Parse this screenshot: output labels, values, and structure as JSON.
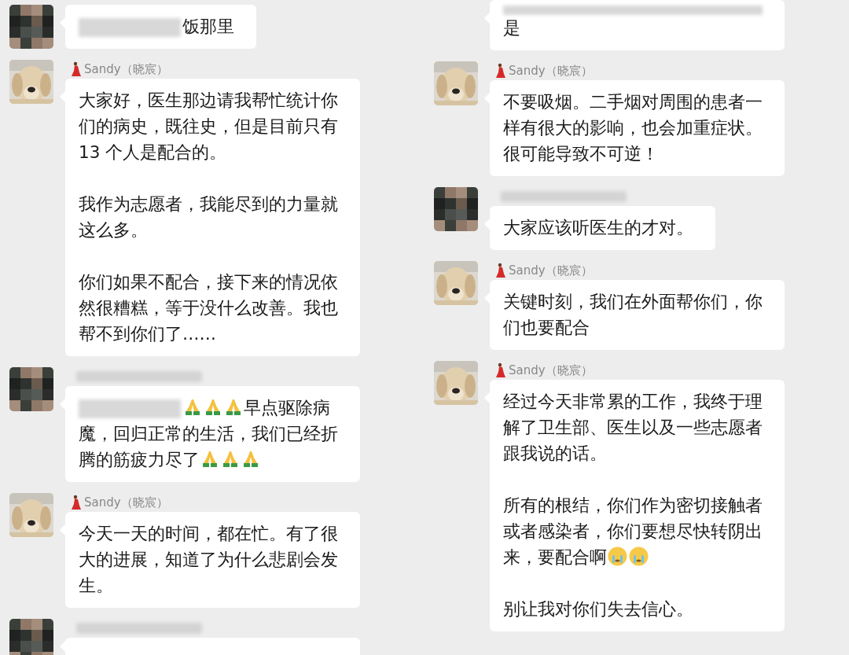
{
  "columns": [
    {
      "messages": [
        {
          "avatar": {
            "kind": "mosaic"
          },
          "paragraphs": [
            [
              [
                {
                  "kind": "blur"
                },
                {
                  "kind": "text",
                  "text": "饭那里"
                }
              ]
            ]
          ]
        },
        {
          "avatar": {
            "kind": "dog"
          },
          "sender": "Sandy（晓宸）",
          "paragraphs": [
            [
              [
                {
                  "kind": "text",
                  "text": "大家好，医生那边请我帮忙统计你们的病史，既往史，但是目前只有13 个人是配合的。"
                }
              ]
            ],
            [
              [
                {
                  "kind": "text",
                  "text": "我作为志愿者，我能尽到的力量就这么多。"
                }
              ]
            ],
            [
              [
                {
                  "kind": "text",
                  "text": "你们如果不配合，接下来的情况依然很糟糕，等于没什么改善。我也帮不到你们了……"
                }
              ]
            ]
          ]
        },
        {
          "avatar": {
            "kind": "mosaic"
          },
          "sender_blurred": true,
          "paragraphs": [
            [
              [
                {
                  "kind": "blur"
                },
                {
                  "kind": "pray"
                },
                {
                  "kind": "pray"
                },
                {
                  "kind": "pray"
                },
                {
                  "kind": "text",
                  "text": "早点驱除病"
                }
              ],
              [
                {
                  "kind": "text",
                  "text": "魔，回归正常的生活，我们已经折"
                }
              ],
              [
                {
                  "kind": "text",
                  "text": "腾的筋疲力尽了"
                },
                {
                  "kind": "pray"
                },
                {
                  "kind": "pray"
                },
                {
                  "kind": "pray"
                }
              ]
            ]
          ]
        },
        {
          "avatar": {
            "kind": "dog"
          },
          "sender": "Sandy（晓宸）",
          "paragraphs": [
            [
              [
                {
                  "kind": "text",
                  "text": "今天一天的时间，都在忙。有了很大的进展，知道了为什么悲剧会发生。"
                }
              ]
            ]
          ]
        },
        {
          "avatar": {
            "kind": "mosaic"
          },
          "sender_blurred": true
        }
      ]
    },
    {
      "messages": [
        {
          "paragraphs": [
            [
              [
                {
                  "kind": "blur"
                }
              ],
              [
                {
                  "kind": "text",
                  "text": "是"
                }
              ]
            ]
          ]
        },
        {
          "avatar": {
            "kind": "dog"
          },
          "sender": "Sandy（晓宸）",
          "paragraphs": [
            [
              [
                {
                  "kind": "text",
                  "text": "不要吸烟。二手烟对周围的患者一样有很大的影响，也会加重症状。很可能导致不可逆！"
                }
              ]
            ]
          ]
        },
        {
          "avatar": {
            "kind": "mosaic"
          },
          "sender_blurred": true,
          "paragraphs": [
            [
              [
                {
                  "kind": "text",
                  "text": "大家应该听医生的才对。"
                }
              ]
            ]
          ]
        },
        {
          "avatar": {
            "kind": "dog"
          },
          "sender": "Sandy（晓宸）",
          "paragraphs": [
            [
              [
                {
                  "kind": "text",
                  "text": "关键时刻，我们在外面帮你们，你们也要配合"
                }
              ]
            ]
          ]
        },
        {
          "avatar": {
            "kind": "dog"
          },
          "sender": "Sandy（晓宸）",
          "paragraphs": [
            [
              [
                {
                  "kind": "text",
                  "text": "经过今天非常累的工作，我终于理解了卫生部、医生以及一些志愿者跟我说的话。"
                }
              ]
            ],
            [
              [
                {
                  "kind": "text",
                  "text": "所有的根结，你们作为密切接触者或者感染者，你们要想尽快转阴出"
                }
              ],
              [
                {
                  "kind": "text",
                  "text": "来，要配合啊"
                },
                {
                  "kind": "cry"
                },
                {
                  "kind": "cry"
                }
              ]
            ],
            [
              [
                {
                  "kind": "text",
                  "text": "别让我对你们失去信心。"
                }
              ]
            ]
          ]
        }
      ]
    }
  ]
}
